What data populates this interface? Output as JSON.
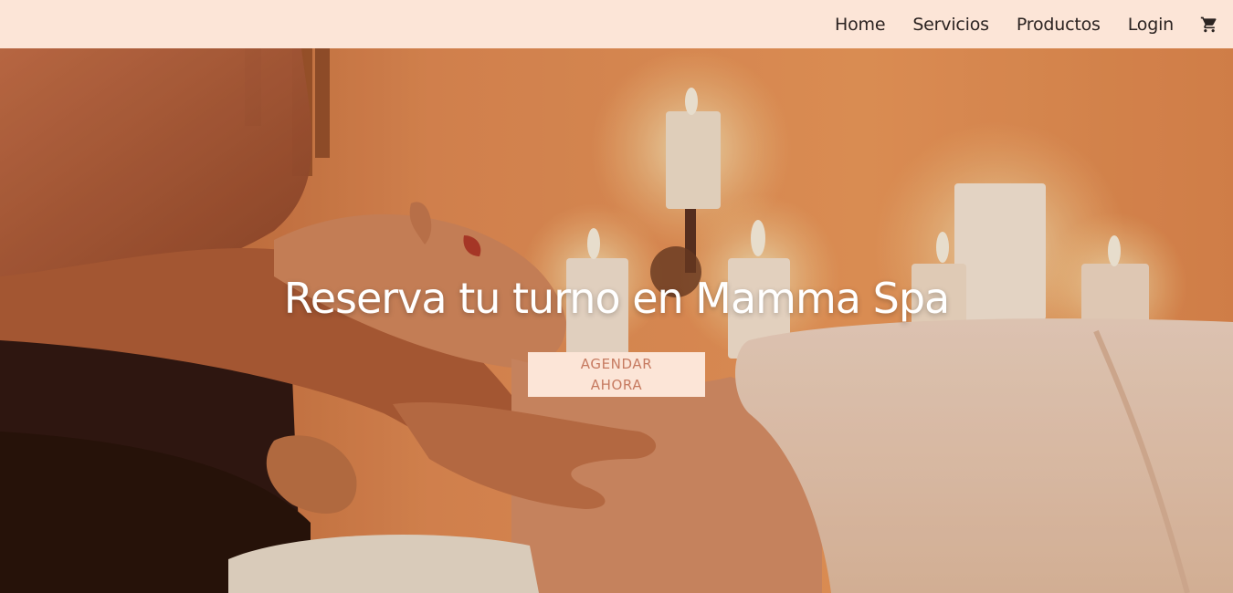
{
  "nav": {
    "links": [
      "Home",
      "Servicios",
      "Productos",
      "Login"
    ],
    "cart_icon": "shopping-cart-icon"
  },
  "hero": {
    "title": "Reserva tu turno en Mamma Spa",
    "cta_line1": "AGENDAR",
    "cta_line2": "AHORA"
  },
  "colors": {
    "nav_bg": "#fce5d7",
    "cta_bg": "#fce5d7",
    "cta_text": "#c67a60",
    "nav_text": "#2b2321",
    "hero_text": "#ffffff"
  }
}
